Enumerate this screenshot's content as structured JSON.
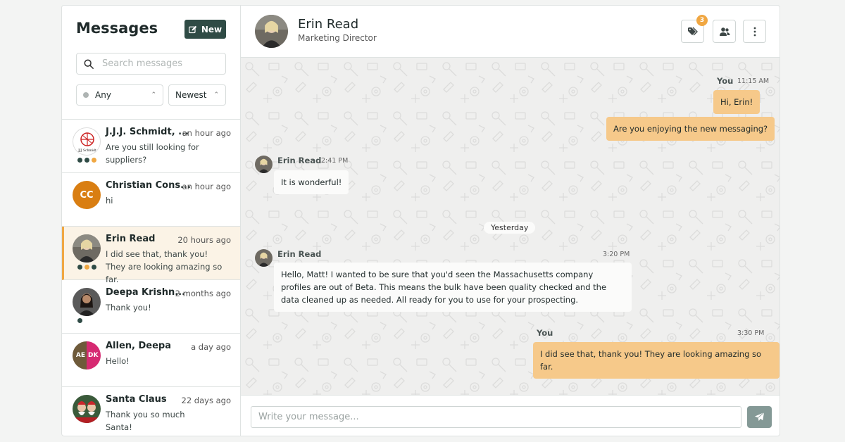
{
  "sidebar": {
    "title": "Messages",
    "new_label": "New",
    "search_placeholder": "Search messages",
    "filter_any": "Any",
    "sort": "Newest",
    "conversations": [
      {
        "name": "J.J.J. Schmidt, ...",
        "time": "an hour ago",
        "preview": "Are you still looking for suppliers?",
        "avatar": "JJJ Schmidt",
        "dots": [
          "#2f4b45",
          "#2f4b45",
          "#f0a742"
        ]
      },
      {
        "name": "Christian Cons...",
        "time": "an hour ago",
        "preview": "hi",
        "avatar": "CC",
        "dots": []
      },
      {
        "name": "Erin Read",
        "time": "20 hours ago",
        "preview": "I did see that, thank you! They are looking amazing so far.",
        "active": true,
        "dots": [
          "#2f4b45",
          "#f0a742",
          "#2f4b45"
        ]
      },
      {
        "name": "Deepa Krishn...",
        "time": "2 months ago",
        "preview": "Thank you!",
        "dots": [
          "#2f4b45"
        ]
      },
      {
        "name": "Allen, Deepa",
        "time": "a day ago",
        "preview": "Hello!",
        "avatar_left": "AE",
        "avatar_right": "DK",
        "dots": []
      },
      {
        "name": "Santa Claus",
        "time": "22 days ago",
        "preview": "Thank you so much Santa!",
        "dots": []
      }
    ]
  },
  "chat": {
    "name": "Erin Read",
    "role": "Marketing Director",
    "tags_badge": "3",
    "messages": [
      {
        "sender": "You",
        "time": "11:15 AM"
      },
      {
        "text": "Hi, Erin!"
      },
      {
        "text": "Are you enjoying the new messaging?"
      },
      {
        "sender": "Erin Read",
        "time": "2:41 PM"
      },
      {
        "text": "It is wonderful!"
      },
      {
        "day": "Yesterday"
      },
      {
        "sender": "Erin Read",
        "time": "3:20 PM"
      },
      {
        "text": "Hello, Matt! I wanted to be sure that you'd seen the Massachusetts company profiles are out of Beta. This means the bulk have been quality checked and the data cleaned up as needed. All ready for you to use for your prospecting."
      },
      {
        "sender": "You",
        "time": "3:30 PM"
      },
      {
        "text": "I did see that, thank you! They are looking amazing so far."
      }
    ],
    "composer_placeholder": "Write your message..."
  },
  "colors": {
    "accent": "#f0a742",
    "brand": "#2f4b45",
    "cc_avatar": "#d97e12"
  },
  "icons": [
    "edit-icon",
    "search-icon",
    "tag-icon",
    "users-icon",
    "kebab-icon",
    "send-icon"
  ]
}
